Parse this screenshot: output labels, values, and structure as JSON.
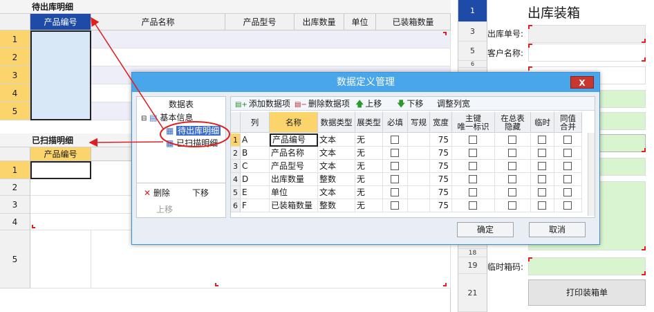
{
  "left": {
    "pending_title": "待出库明细",
    "pending_columns": [
      "产品编号",
      "产品名称",
      "产品型号",
      "出库数量",
      "单位",
      "已装箱数量"
    ],
    "pending_rows": [
      "1",
      "2",
      "3",
      "4",
      "5"
    ],
    "scanned_title": "已扫描明细",
    "scanned_columns": [
      "产品编号"
    ],
    "scanned_rows": [
      "1",
      "2",
      "3",
      "4",
      "5"
    ]
  },
  "right": {
    "title": "出库装箱",
    "row_numbers": [
      "1",
      "3",
      "5",
      "6",
      "18",
      "19",
      "21"
    ],
    "labels": {
      "order_no": "出库单号:",
      "customer": "客户名称:",
      "box_code": "临时箱码:"
    },
    "print_button": "打印装箱单"
  },
  "dialog": {
    "title": "数据定义管理",
    "close": "X",
    "tree_header": "数据表",
    "tree_root": "基本信息",
    "tree_children": [
      "待出库明细",
      "已扫描明细"
    ],
    "delete": "删除",
    "move_down": "下移",
    "move_up": "上移",
    "toolbar": {
      "add": "添加数据项",
      "remove": "删除数据项",
      "up": "上移",
      "down": "下移",
      "fit": "调整列宽"
    },
    "grid_headers": [
      "列",
      "名称",
      "数据类型",
      "扩展类型",
      "必填",
      "写规则",
      "宽度",
      "主键(唯一标识)",
      "在总表隐藏",
      "临时",
      "同值合并"
    ],
    "grid_header_display": [
      "列",
      "名称",
      "数据类型",
      "展类型",
      "必填",
      "写规",
      "宽度",
      "主键\n唯一标识",
      "在总表\n隐藏",
      "临时",
      "同值\n合并"
    ],
    "rows": [
      {
        "num": "1",
        "col": "A",
        "name": "产品编号",
        "type": "文本",
        "ext": "无",
        "width": "75"
      },
      {
        "num": "2",
        "col": "B",
        "name": "产品名称",
        "type": "文本",
        "ext": "无",
        "width": "75"
      },
      {
        "num": "3",
        "col": "C",
        "name": "产品型号",
        "type": "文本",
        "ext": "无",
        "width": "75"
      },
      {
        "num": "4",
        "col": "D",
        "name": "出库数量",
        "type": "整数",
        "ext": "无",
        "width": "75"
      },
      {
        "num": "5",
        "col": "E",
        "name": "单位",
        "type": "文本",
        "ext": "无",
        "width": "75"
      },
      {
        "num": "6",
        "col": "F",
        "name": "已装箱数量",
        "type": "整数",
        "ext": "无",
        "width": "75"
      }
    ],
    "ok": "确定",
    "cancel": "取消"
  },
  "colors": {
    "accent_blue": "#1e4aa8",
    "title_bar": "#49a6e8",
    "highlight_yellow": "#fbd56b",
    "annotation_red": "#e02020",
    "green_field": "#d8f5d0"
  }
}
